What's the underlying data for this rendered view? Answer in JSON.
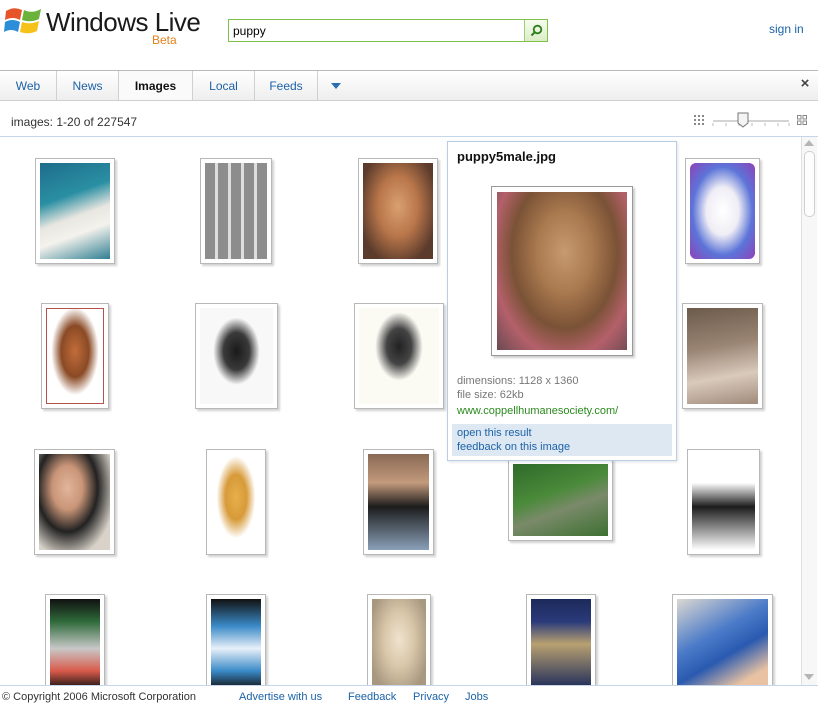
{
  "header": {
    "logo_text": "Windows Live",
    "logo_badge": "Beta",
    "search_value": "puppy",
    "sign_in": "sign in"
  },
  "tabs": [
    {
      "label": "Web",
      "active": false
    },
    {
      "label": "News",
      "active": false
    },
    {
      "label": "Images",
      "active": true
    },
    {
      "label": "Local",
      "active": false
    },
    {
      "label": "Feeds",
      "active": false
    }
  ],
  "results": {
    "count_text": "images: 1-20 of 227547"
  },
  "popup": {
    "title": "puppy5male.jpg",
    "dimensions": "dimensions: 1128 x 1360",
    "file_size": "file size: 62kb",
    "url": "www.coppellhumanesociety.com/",
    "open_label": "open this result",
    "feedback_label": "feedback on this image"
  },
  "footer": {
    "copyright": "© Copyright 2006 Microsoft Corporation",
    "links": [
      "Advertise with us",
      "Feedback",
      "Privacy",
      "Jobs"
    ]
  },
  "colors": {
    "link": "#1c62a8",
    "url_green": "#2a8a1e",
    "brand_orange": "#e4801b",
    "search_border": "#7fc04a"
  }
}
